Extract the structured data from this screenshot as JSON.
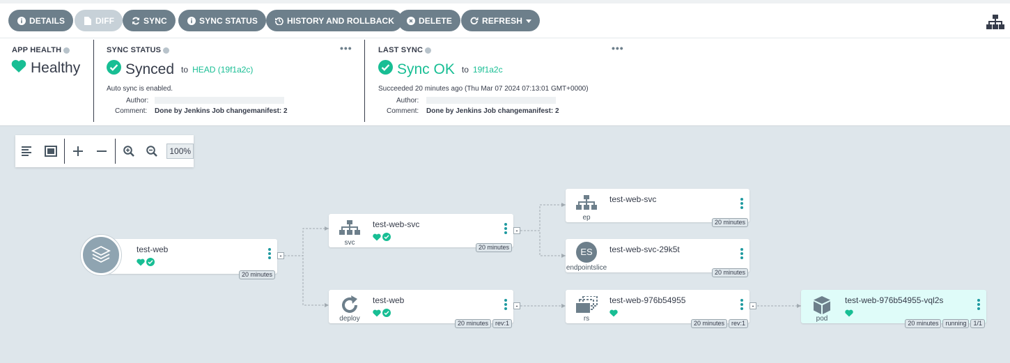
{
  "toolbar": {
    "buttons": [
      {
        "label": "DETAILS",
        "icon": "info-circle-icon"
      },
      {
        "label": "DIFF",
        "icon": "file-icon"
      },
      {
        "label": "SYNC",
        "icon": "sync-icon"
      },
      {
        "label": "SYNC STATUS",
        "icon": "info-circle-icon"
      },
      {
        "label": "HISTORY AND ROLLBACK",
        "icon": "history-icon"
      },
      {
        "label": "DELETE",
        "icon": "times-circle-icon"
      },
      {
        "label": "REFRESH",
        "icon": "redo-icon"
      }
    ],
    "tree_view_icon": "sitemap-icon"
  },
  "app_health": {
    "title": "APP HEALTH",
    "value": "Healthy"
  },
  "sync_status": {
    "title": "SYNC STATUS",
    "value": "Synced",
    "to_prefix": "to",
    "revision": "HEAD (19f1a2c)",
    "auto_sync": "Auto sync is enabled.",
    "author_label": "Author:",
    "author_value": "",
    "comment_label": "Comment:",
    "comment_value": "Done by Jenkins Job changemanifest: 2",
    "more": "•••"
  },
  "last_sync": {
    "title": "LAST SYNC",
    "value": "Sync OK",
    "to_prefix": "to",
    "revision": "19f1a2c",
    "succeeded": "Succeeded 20 minutes ago (Thu Mar 07 2024 07:13:01 GMT+0000)",
    "author_label": "Author:",
    "author_value": "",
    "comment_label": "Comment:",
    "comment_value": "Done by Jenkins Job changemanifest: 2",
    "more": "•••"
  },
  "graph_tools": {
    "zoom": "100%"
  },
  "colors": {
    "healthy": "#18be94",
    "button": "#6d7f8b",
    "pod_bg": "#dffcf9"
  },
  "nodes": {
    "app": {
      "name": "test-web",
      "age": "20 minutes"
    },
    "svc": {
      "name": "test-web-svc",
      "kind": "svc",
      "age": "20 minutes"
    },
    "deploy": {
      "name": "test-web",
      "kind": "deploy",
      "age": "20 minutes",
      "rev": "rev:1"
    },
    "ep": {
      "name": "test-web-svc",
      "kind": "ep",
      "age": "20 minutes"
    },
    "es": {
      "name": "test-web-svc-29k5t",
      "kind": "endpointslice",
      "icon_text": "ES",
      "age": "20 minutes"
    },
    "rs": {
      "name": "test-web-976b54955",
      "kind": "rs",
      "age": "20 minutes",
      "rev": "rev:1"
    },
    "pod": {
      "name": "test-web-976b54955-vql2s",
      "kind": "pod",
      "age": "20 minutes",
      "status": "running",
      "ready": "1/1"
    }
  }
}
